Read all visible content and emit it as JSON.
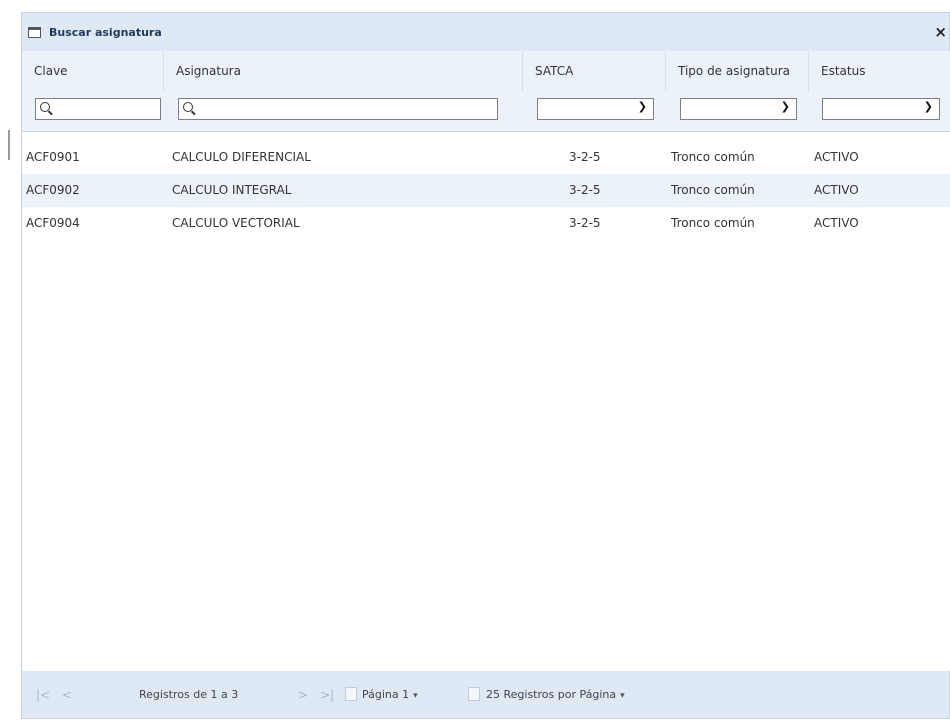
{
  "dialog": {
    "title": "Buscar asignatura",
    "close": "×"
  },
  "grid": {
    "columns": [
      "Clave",
      "Asignatura",
      "SATCA",
      "Tipo de asignatura",
      "Estatus"
    ],
    "rows": [
      {
        "clave": "ACF0901",
        "asignatura": "CALCULO DIFERENCIAL",
        "satca": "3-2-5",
        "tipo": "Tronco común",
        "estatus": "ACTIVO"
      },
      {
        "clave": "ACF0902",
        "asignatura": "CALCULO INTEGRAL",
        "satca": "3-2-5",
        "tipo": "Tronco común",
        "estatus": "ACTIVO"
      },
      {
        "clave": "ACF0904",
        "asignatura": "CALCULO VECTORIAL",
        "satca": "3-2-5",
        "tipo": "Tronco común",
        "estatus": "ACTIVO"
      }
    ]
  },
  "pager": {
    "first": "|<",
    "prev": "<",
    "records": "Registros de 1 a 3",
    "next": ">",
    "last": ">|",
    "page": "Página 1",
    "per_page": "25 Registros por Página",
    "dropdown": "▾"
  },
  "icons": {
    "search": "search-icon",
    "select": "chevron-down-icon",
    "window": "window-icon"
  }
}
